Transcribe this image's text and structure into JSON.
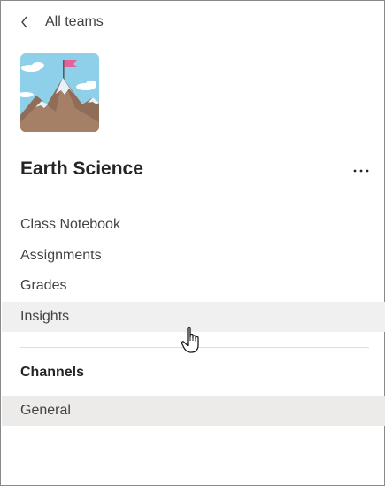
{
  "nav": {
    "back_label": "All teams",
    "back_icon": "chevron-left-icon"
  },
  "team": {
    "name": "Earth Science",
    "avatar_icon": "mountain-flag-icon",
    "more_icon": "more-options-icon"
  },
  "menu": {
    "items": [
      {
        "label": "Class Notebook"
      },
      {
        "label": "Assignments"
      },
      {
        "label": "Grades"
      },
      {
        "label": "Insights"
      }
    ]
  },
  "channels": {
    "header": "Channels",
    "items": [
      {
        "label": "General"
      }
    ]
  },
  "colors": {
    "hover_bg": "#f0f0f0",
    "selected_bg": "#edebe9",
    "text": "#252424",
    "sky": "#8ed0ea",
    "mountain": "#a57f66",
    "flag": "#e6609a"
  }
}
